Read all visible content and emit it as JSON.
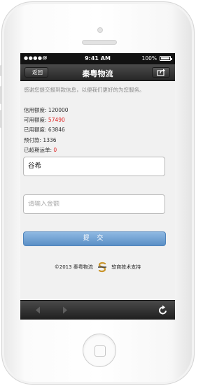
{
  "status_bar": {
    "signal": "●●●●○",
    "wifi": "≋",
    "time": "9:41 AM",
    "battery": "100%"
  },
  "nav": {
    "back_label": "返回",
    "title": "秦粤物流",
    "share_icon": "share-icon"
  },
  "notice": "感谢您提交报到款信息，以便我们更好的为您服务。",
  "info": [
    {
      "label": "信用额度:",
      "value": "120000",
      "highlight": false
    },
    {
      "label": "可用额度:",
      "value": "57490",
      "highlight": true
    },
    {
      "label": "已用额度:",
      "value": "63846",
      "highlight": false
    },
    {
      "label": "预付款:",
      "value": "1336",
      "highlight": false
    },
    {
      "label": "已超期运单:",
      "value": "0",
      "highlight": true
    }
  ],
  "name_field": {
    "value": "谷希"
  },
  "amount_field": {
    "placeholder": "请输入金额",
    "value": ""
  },
  "submit_label": "提 交",
  "footer": {
    "copyright": "©2013 秦粤物流",
    "support": "软商技术支持"
  },
  "colors": {
    "accent": "#6f9fd2",
    "highlight": "#e02020",
    "bar": "#2a2a2a"
  }
}
